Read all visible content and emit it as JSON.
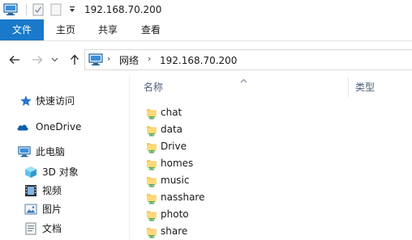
{
  "window": {
    "title": "192.168.70.200"
  },
  "quick_access_toolbar": {
    "icons": [
      "computer-icon",
      "properties-icon",
      "new-folder-icon",
      "customize-dropdown-icon"
    ]
  },
  "ribbon": {
    "tabs": [
      {
        "label": "文件",
        "active": true
      },
      {
        "label": "主页"
      },
      {
        "label": "共享"
      },
      {
        "label": "查看"
      }
    ],
    "accent_color": "#1979ca"
  },
  "address_bar": {
    "breadcrumbs": [
      {
        "label": "网络"
      },
      {
        "label": "192.168.70.200"
      }
    ]
  },
  "nav_pane": {
    "items": [
      {
        "label": "快速访问",
        "icon": "star-icon"
      },
      {
        "label": "OneDrive",
        "icon": "cloud-icon"
      },
      {
        "label": "此电脑",
        "icon": "computer-icon"
      },
      {
        "label": "3D 对象",
        "icon": "3d-objects-icon"
      },
      {
        "label": "视频",
        "icon": "video-icon"
      },
      {
        "label": "图片",
        "icon": "pictures-icon"
      },
      {
        "label": "文档",
        "icon": "documents-icon"
      }
    ]
  },
  "file_list": {
    "columns": [
      {
        "label": "名称",
        "sorted": "ascending"
      },
      {
        "label": "类型"
      }
    ],
    "rows": [
      {
        "name": "chat",
        "icon": "shared-folder-icon"
      },
      {
        "name": "data",
        "icon": "shared-folder-icon"
      },
      {
        "name": "Drive",
        "icon": "shared-folder-icon"
      },
      {
        "name": "homes",
        "icon": "shared-folder-icon"
      },
      {
        "name": "music",
        "icon": "shared-folder-icon"
      },
      {
        "name": "nasshare",
        "icon": "shared-folder-icon"
      },
      {
        "name": "photo",
        "icon": "shared-folder-icon"
      },
      {
        "name": "share",
        "icon": "shared-folder-icon"
      }
    ]
  }
}
